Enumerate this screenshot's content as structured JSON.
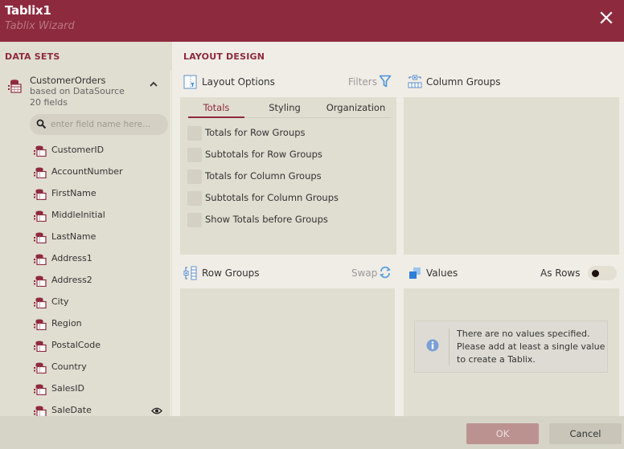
{
  "window": {
    "title": "Tablix1",
    "subtitle": "Tablix Wizard",
    "close_icon": "close-icon"
  },
  "colors": {
    "brand": "#8e2a3e",
    "accent_blue": "#2f7ed8",
    "ok_disabled": "#bc9290"
  },
  "sidebar": {
    "section_title": "DATA SETS",
    "dataset": {
      "name": "CustomerOrders",
      "source": "based on DataSource",
      "field_count": "20 fields",
      "expanded": true
    },
    "search": {
      "placeholder": "enter field name here...",
      "value": ""
    },
    "fields": [
      {
        "label": "CustomerID"
      },
      {
        "label": "AccountNumber"
      },
      {
        "label": "FirstName"
      },
      {
        "label": "MiddleInitial"
      },
      {
        "label": "LastName"
      },
      {
        "label": "Address1"
      },
      {
        "label": "Address2"
      },
      {
        "label": "City"
      },
      {
        "label": "Region"
      },
      {
        "label": "PostalCode"
      },
      {
        "label": "Country"
      },
      {
        "label": "SalesID"
      },
      {
        "label": "SaleDate",
        "hover_icon": "eye-icon"
      }
    ]
  },
  "main": {
    "section_title": "LAYOUT DESIGN",
    "layout_options": {
      "title": "Layout Options",
      "action_label": "Filters",
      "tabs": [
        {
          "label": "Totals",
          "active": true
        },
        {
          "label": "Styling",
          "active": false
        },
        {
          "label": "Organization",
          "active": false
        }
      ],
      "options": [
        {
          "label": "Totals for Row Groups",
          "checked": false
        },
        {
          "label": "Subtotals for Row Groups",
          "checked": false
        },
        {
          "label": "Totals for Column Groups",
          "checked": false
        },
        {
          "label": "Subtotals for Column Groups",
          "checked": false
        },
        {
          "label": "Show Totals before Groups",
          "checked": false
        }
      ]
    },
    "column_groups": {
      "title": "Column Groups"
    },
    "row_groups": {
      "title": "Row Groups",
      "action_label": "Swap"
    },
    "values": {
      "title": "Values",
      "toggle_label": "As Rows",
      "toggle_on": false,
      "empty_message": "There are no values specified. Please add at least a single value to create a Tablix."
    }
  },
  "footer": {
    "ok_label": "OK",
    "cancel_label": "Cancel"
  }
}
